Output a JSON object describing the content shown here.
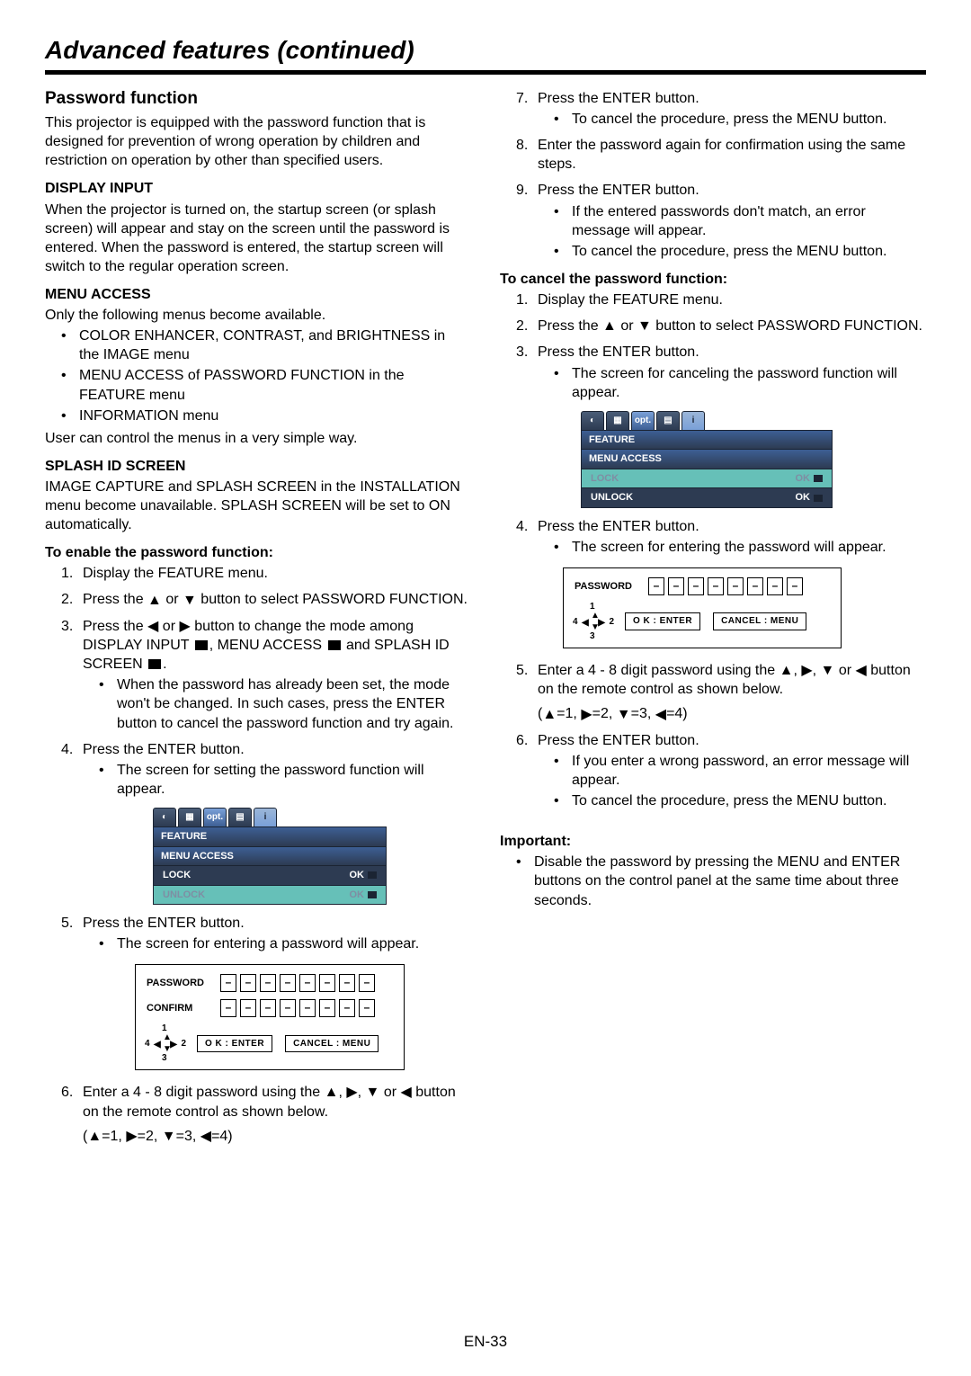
{
  "page": {
    "title": "Advanced features (continued)",
    "footer": "EN-33"
  },
  "left": {
    "h1": "Password function",
    "intro": "This projector is equipped with the password function that is designed for prevention of wrong operation by children and restriction on operation by other than specified users.",
    "display_input_h": "DISPLAY INPUT",
    "display_input_p": "When the projector is turned on, the startup screen (or splash screen) will appear and stay on the screen until the password is entered. When the password is entered, the startup screen will switch to the regular operation screen.",
    "menu_access_h": "MENU ACCESS",
    "menu_access_p": "Only the following menus become available.",
    "menu_access_items": [
      "COLOR ENHANCER, CONTRAST, and BRIGHTNESS in the IMAGE menu",
      "MENU ACCESS of PASSWORD FUNCTION in the FEATURE menu",
      "INFORMATION menu"
    ],
    "menu_access_tail": "User can control the menus in a very simple way.",
    "splash_h": "SPLASH ID SCREEN",
    "splash_p": "IMAGE CAPTURE and SPLASH SCREEN in the INSTALLATION menu become unavailable. SPLASH SCREEN will be set to ON automatically.",
    "enable_h": "To enable the password function:",
    "steps": {
      "s1": "Display the FEATURE menu.",
      "s2a": "Press the ",
      "s2b": " or ",
      "s2c": " button to select PASSWORD FUNCTION.",
      "s3a": "Press the ",
      "s3b": " or ",
      "s3c": " button to change the mode among DISPLAY INPUT ",
      "s3d": ", MENU ACCESS ",
      "s3e": " and SPLASH ID SCREEN ",
      "s3f": ".",
      "s3_bul": "When the password has already been set, the mode won't be changed. In such cases, press the ENTER button to cancel the password function and try again.",
      "s4": "Press the ENTER button.",
      "s4_bul": "The screen for setting the password function will appear.",
      "s5": "Press the ENTER button.",
      "s5_bul": "The screen for entering a password will appear.",
      "s6a": "Enter a 4 - 8 digit password using the ",
      "s6b": ", ",
      "s6c": ", ",
      "s6d": " or ",
      "s6e": " button on the remote control as shown below.",
      "s6_map_a": "(",
      "s6_map_b": "=1, ",
      "s6_map_c": "=2, ",
      "s6_map_d": "=3, ",
      "s6_map_e": "=4)"
    },
    "osd": {
      "feature": "FEATURE",
      "menu_access": "MENU ACCESS",
      "lock": "LOCK",
      "unlock": "UNLOCK",
      "ok": "OK",
      "opt": "opt."
    },
    "pwbox": {
      "password": "PASSWORD",
      "confirm": "CONFIRM",
      "dash": "–",
      "ok_enter": "O K : ENTER",
      "cancel_menu": "CANCEL : MENU",
      "n1": "1",
      "n2": "2",
      "n3": "3",
      "n4": "4"
    }
  },
  "right": {
    "steps": {
      "s7": "Press the ENTER button.",
      "s7_bul": "To cancel the procedure, press the MENU button.",
      "s8": "Enter the password again for confirmation using the same steps.",
      "s9": "Press the ENTER button.",
      "s9_bul1": "If the entered passwords don't match, an error message will appear.",
      "s9_bul2": "To cancel the procedure, press the MENU button."
    },
    "cancel_h": "To cancel the password function:",
    "csteps": {
      "s1": "Display the FEATURE menu.",
      "s2a": "Press the ",
      "s2b": " or ",
      "s2c": " button to select PASSWORD FUNCTION.",
      "s3": "Press the ENTER button.",
      "s3_bul": "The screen for canceling the password function will appear.",
      "s4": "Press the ENTER button.",
      "s4_bul": "The screen for entering the password will appear.",
      "s5a": "Enter a 4 - 8 digit password using the ",
      "s5b": ", ",
      "s5c": ", ",
      "s5d": " or ",
      "s5e": " button on the remote control as shown below.",
      "s5_map_a": "(",
      "s5_map_b": "=1, ",
      "s5_map_c": "=2, ",
      "s5_map_d": "=3, ",
      "s5_map_e": "=4)",
      "s6": "Press the ENTER button.",
      "s6_bul1": "If you enter a wrong password, an error message will appear.",
      "s6_bul2": "To cancel the procedure, press the MENU button."
    },
    "osd": {
      "feature": "FEATURE",
      "menu_access": "MENU ACCESS",
      "lock": "LOCK",
      "unlock": "UNLOCK",
      "ok": "OK",
      "opt": "opt."
    },
    "pwbox": {
      "password": "PASSWORD",
      "dash": "–",
      "ok_enter": "O K : ENTER",
      "cancel_menu": "CANCEL : MENU",
      "n1": "1",
      "n2": "2",
      "n3": "3",
      "n4": "4"
    },
    "important_h": "Important:",
    "important_bul": "Disable the password by pressing the MENU and ENTER buttons on the control panel at the same time about three seconds."
  }
}
